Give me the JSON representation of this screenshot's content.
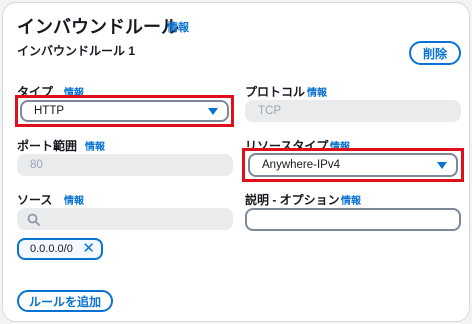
{
  "header": {
    "title": "インバウンドルール",
    "title_info": "情報",
    "rule_name": "インバウンドルール 1",
    "delete_label": "削除"
  },
  "type_field": {
    "label": "タイプ",
    "info": "情報",
    "value": "HTTP"
  },
  "protocol_field": {
    "label": "プロトコル",
    "info": "情報",
    "value": "TCP"
  },
  "port_field": {
    "label": "ポート範囲",
    "info": "情報",
    "value": "80"
  },
  "resource_type_field": {
    "label": "リソースタイプ",
    "info": "情報",
    "value": "Anywhere-IPv4"
  },
  "source_field": {
    "label": "ソース",
    "info": "情報",
    "placeholder": "",
    "token": "0.0.0.0/0"
  },
  "description_field": {
    "label": "説明 - オプション",
    "info": "情報",
    "value": ""
  },
  "footer": {
    "add_rule_label": "ルールを追加"
  },
  "colors": {
    "accent": "#0972d3",
    "highlight": "#e0101a",
    "disabled_bg": "#e9ebed"
  },
  "icons": {
    "dropdown": "caret-down-icon",
    "search": "search-icon",
    "remove": "close-icon"
  }
}
